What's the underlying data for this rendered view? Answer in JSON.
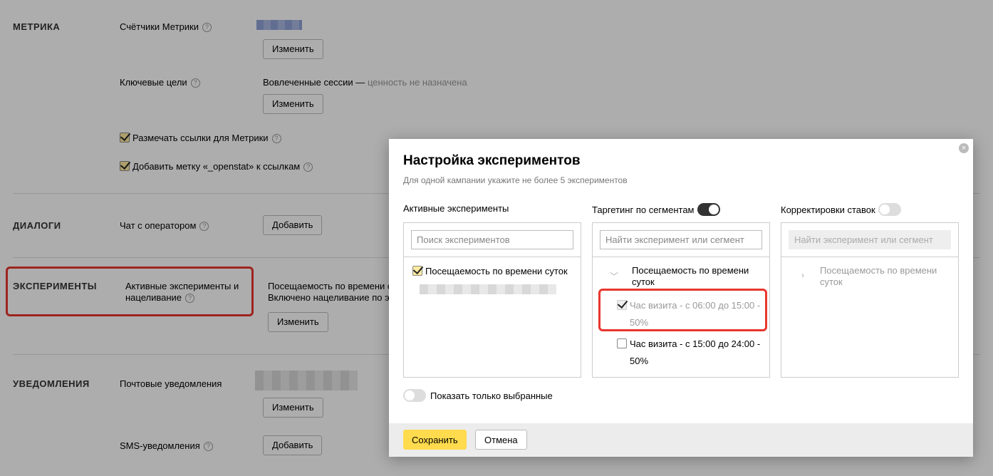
{
  "sections": {
    "metrika": {
      "title": "МЕТРИКА",
      "counters_label": "Счётчики Метрики",
      "change_label": "Изменить",
      "key_goals_label": "Ключевые цели",
      "key_goals_value": "Вовлеченные сессии —",
      "key_goals_note": "ценность не назначена",
      "change2_label": "Изменить",
      "mark_links_label": "Размечать ссылки для Метрики",
      "openstat_label": "Добавить метку «_openstat» к ссылкам"
    },
    "dialogs": {
      "title": "ДИАЛОГИ",
      "chat_label": "Чат с оператором",
      "add_label": "Добавить"
    },
    "experiments": {
      "title": "ЭКСПЕРИМЕНТЫ",
      "active_label_1": "Активные эксперименты и",
      "active_label_2": "нацеливание",
      "value_1": "Посещаемость по времени с",
      "value_2": "Включено нацеливание по э",
      "change_label": "Изменить"
    },
    "notifications": {
      "title": "УВЕДОМЛЕНИЯ",
      "mail_label": "Почтовые уведомления",
      "change_label": "Изменить",
      "sms_label": "SMS-уведомления",
      "add_label": "Добавить"
    }
  },
  "modal": {
    "title": "Настройка экспериментов",
    "subtitle": "Для одной кампании укажите не более 5 экспериментов",
    "close_glyph": "×",
    "col1": {
      "header": "Активные эксперименты",
      "placeholder": "Поиск экспериментов",
      "item": "Посещаемость по времени суток"
    },
    "col2": {
      "header": "Таргетинг по сегментам",
      "toggle": "on",
      "placeholder": "Найти эксперимент или сегмент",
      "group_1": "Посещаемость по времени",
      "group_2": "суток",
      "seg1_1": "Час визита - с 06:00 до 15:00 -",
      "seg1_2": "50%",
      "seg2_1": "Час визита - с 15:00 до 24:00 -",
      "seg2_2": "50%"
    },
    "col3": {
      "header": "Корректировки ставок",
      "toggle": "off",
      "placeholder": "Найти эксперимент или сегмент",
      "group_1": "Посещаемость по времени",
      "group_2": "суток"
    },
    "show_selected": "Показать только выбранные",
    "save": "Сохранить",
    "cancel": "Отмена"
  },
  "colors": {
    "accent": "#ffdb4d",
    "highlight": "#e8362e"
  }
}
